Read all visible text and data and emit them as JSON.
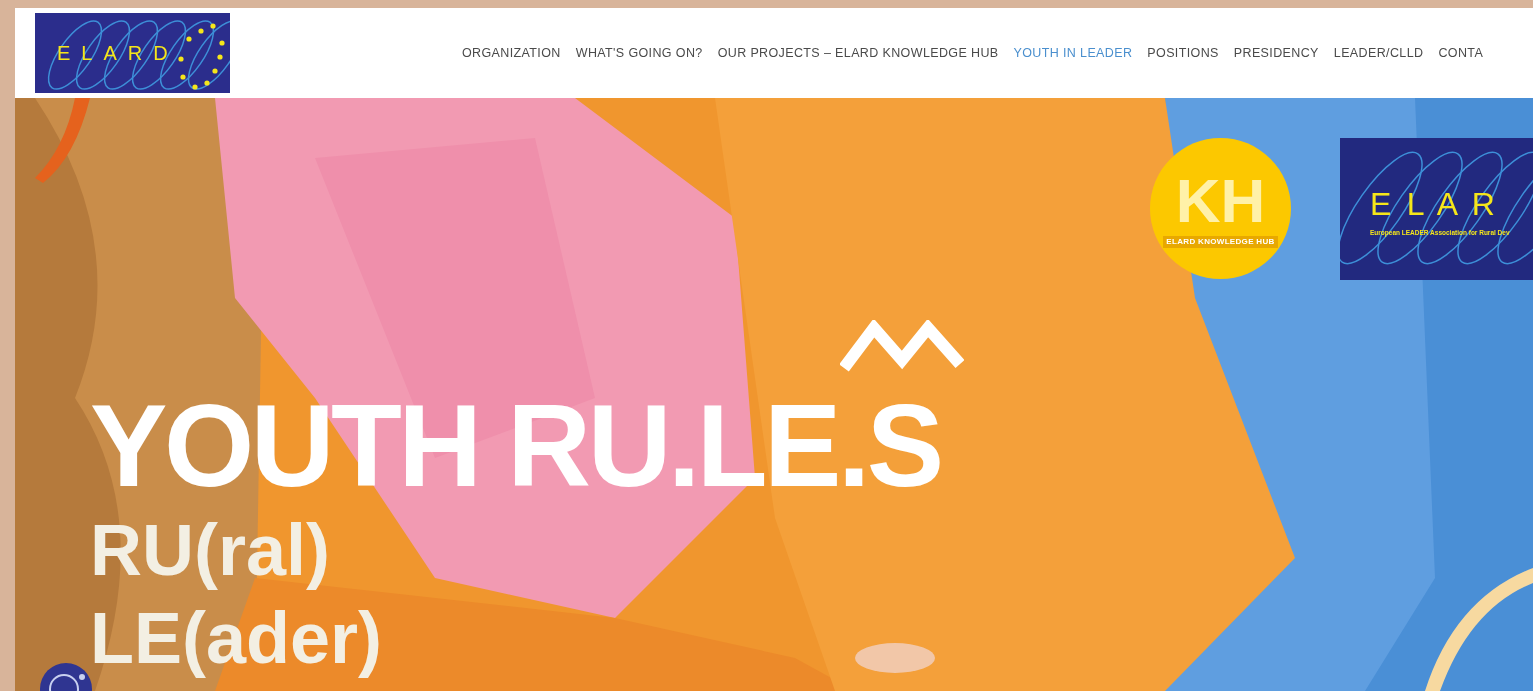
{
  "header": {
    "logo": {
      "text": "ELARD"
    },
    "nav": [
      {
        "label": "ORGANIZATION",
        "selected": false
      },
      {
        "label": "WHAT'S GOING ON?",
        "selected": false
      },
      {
        "label": "OUR PROJECTS – ELARD KNOWLEDGE HUB",
        "selected": false
      },
      {
        "label": "YOUTH IN LEADER",
        "selected": true
      },
      {
        "label": "POSITIONS",
        "selected": false
      },
      {
        "label": "PRESIDENCY",
        "selected": false
      },
      {
        "label": "LEADER/CLLD",
        "selected": false
      },
      {
        "label": "CONTA",
        "selected": false
      }
    ]
  },
  "hero": {
    "kh_badge": {
      "monogram": "KH",
      "label": "ELARD KNOWLEDGE HUB"
    },
    "elard_badge": {
      "name": "E L A R",
      "subtitle": "European LEADER Association for Rural Dev"
    },
    "headline": "YOUTH RU.LE.S",
    "lines": [
      "RU(ral)",
      "LE(ader)"
    ]
  }
}
